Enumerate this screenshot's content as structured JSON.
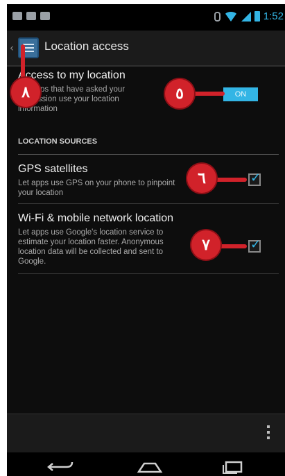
{
  "status": {
    "time": "1:52"
  },
  "actionbar": {
    "title": "Location access"
  },
  "items": {
    "access": {
      "title": "Access to my location",
      "subtitle_lines": [
        "Let apps that have asked your",
        "permission use your location",
        "information"
      ],
      "toggle": "ON"
    },
    "section": "LOCATION SOURCES",
    "gps": {
      "title": "GPS satellites",
      "subtitle_lines": [
        "Let apps use GPS on your phone to pinpoint",
        "your location"
      ],
      "checked": true
    },
    "wifi": {
      "title": "Wi-Fi & mobile network location",
      "subtitle_lines": [
        "Let apps use Google's location service to",
        "estimate your location faster. Anonymous",
        "location data will be collected and sent to",
        "Google."
      ],
      "checked": true
    }
  },
  "annotations": {
    "badge_8": "٨",
    "badge_5": "٥",
    "badge_6": "٦",
    "badge_7": "٧"
  },
  "colors": {
    "accent": "#33b5e5",
    "badge": "#d1222a"
  }
}
